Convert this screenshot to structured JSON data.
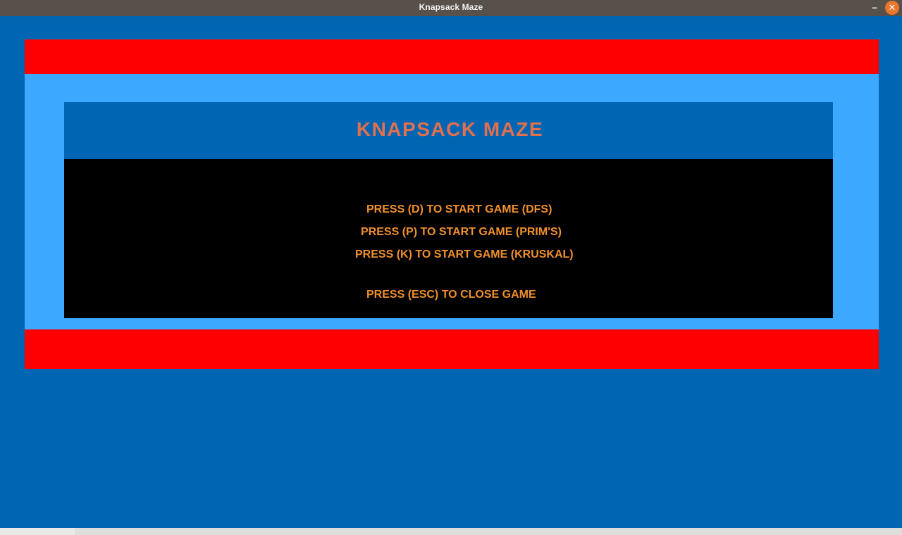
{
  "window": {
    "title": "Knapsack Maze",
    "minimize_glyph": "–",
    "close_glyph": "✕"
  },
  "game": {
    "title": "KNAPSACK MAZE",
    "options": [
      {
        "key": "D",
        "label": "PRESS (D) TO START GAME (DFS)"
      },
      {
        "key": "P",
        "label": "PRESS (P) TO START GAME (PRIM'S)"
      },
      {
        "key": "K",
        "label": "PRESS (K) TO START GAME (KRUSKAL)"
      }
    ],
    "exit": {
      "key": "ESC",
      "label": "PRESS (ESC) TO CLOSE GAME"
    }
  },
  "colors": {
    "background_blue": "#0066b4",
    "frame_light_blue": "#3ca8ff",
    "band_red": "#ff0000",
    "title_text": "#e2704e",
    "menu_text": "#f0902c",
    "menu_panel": "#000000",
    "titlebar": "#58504b",
    "close_button": "#e8762b"
  }
}
